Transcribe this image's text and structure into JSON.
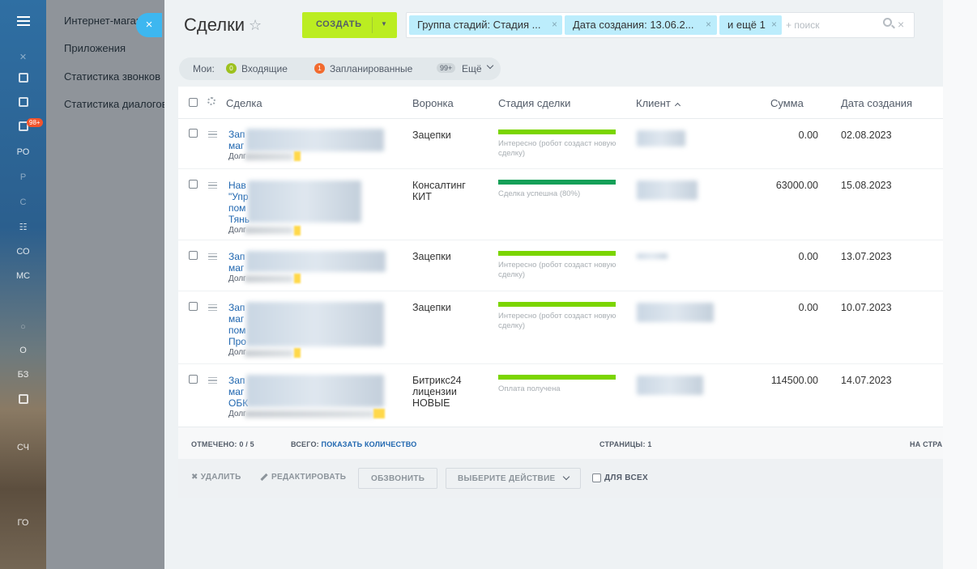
{
  "rail": {
    "items": [
      {
        "label": "",
        "top": 0
      },
      {
        "label": "РО"
      },
      {
        "label": "Р"
      },
      {
        "label": "С"
      },
      {
        "label": "СО"
      },
      {
        "label": "МС"
      },
      {
        "label": "О"
      },
      {
        "label": "БЗ"
      },
      {
        "label": "СЧ"
      },
      {
        "label": "ГО"
      }
    ],
    "badge": "98+"
  },
  "submenu": {
    "items": [
      "Интернет-магазин",
      "Приложения",
      "Статистика звонков",
      "Статистика диалогов"
    ],
    "close_icon": "×"
  },
  "header": {
    "title": "Сделки",
    "star_icon": "☆",
    "create_label": "СОЗДАТЬ",
    "create_arrow": "▼"
  },
  "filter": {
    "chips": [
      "Группа стадий: Стадия ...",
      "Дата создания: 13.06.2...",
      "и ещё 1"
    ],
    "chip_close": "×",
    "search_placeholder": "+ поиск",
    "clear_icon": "×"
  },
  "counters": {
    "label": "Мои:",
    "incoming": "Входящие",
    "incoming_badge": "0",
    "planned": "Запланированные",
    "planned_badge": "1",
    "more_badge": "99+",
    "more": "Ещё"
  },
  "grid": {
    "columns": [
      "Сделка",
      "Воронка",
      "Стадия сделки",
      "Клиент",
      "Сумма",
      "Дата создания"
    ],
    "rows": [
      {
        "deal_lines": [
          "Зап",
          "маг"
        ],
        "resp": "Долг",
        "funnel": [
          "Зацепки"
        ],
        "stage": "Интересно (робот создаст новую сделку)",
        "stage_type": "interest",
        "amount": "0.00",
        "date": "02.08.2023"
      },
      {
        "deal_lines": [
          "Нав",
          "\"Упр",
          "пом",
          "Тянь"
        ],
        "resp": "Долг",
        "funnel": [
          "Консалтинг",
          "КИТ"
        ],
        "stage": "Сделка успешна (80%)",
        "stage_type": "success",
        "amount": "63000.00",
        "date": "15.08.2023"
      },
      {
        "deal_lines": [
          "Зап",
          "маг"
        ],
        "resp": "Долг",
        "funnel": [
          "Зацепки"
        ],
        "stage": "Интересно (робот создаст новую сделку)",
        "stage_type": "interest",
        "amount": "0.00",
        "date": "13.07.2023"
      },
      {
        "deal_lines": [
          "Зап",
          "маг",
          "пом",
          "Про"
        ],
        "resp": "Долг",
        "funnel": [
          "Зацепки"
        ],
        "stage": "Интересно (робот создаст новую сделку)",
        "stage_type": "interest",
        "amount": "0.00",
        "date": "10.07.2023"
      },
      {
        "deal_lines": [
          "Зап",
          "маг",
          "ОБК"
        ],
        "resp": "Долг",
        "funnel": [
          "Битрикс24",
          "лицензии",
          "НОВЫЕ"
        ],
        "stage": "Оплата получена",
        "stage_type": "interest",
        "amount": "114500.00",
        "date": "14.07.2023"
      }
    ]
  },
  "footer": {
    "checked": "ОТМЕЧЕНО: 0 / 5",
    "total_label": "ВСЕГО:",
    "total_link": "ПОКАЗАТЬ КОЛИЧЕСТВО",
    "pages": "СТРАНИЦЫ: 1",
    "per_page": "НА СТРА"
  },
  "actions": {
    "delete": "УДАЛИТЬ",
    "delete_icon": "✖",
    "edit": "РЕДАКТИРОВАТЬ",
    "call": "ОБЗВОНИТЬ",
    "select_action": "ВЫБЕРИТЕ ДЕЙСТВИЕ",
    "for_all": "ДЛЯ ВСЕХ"
  },
  "colors": {
    "create_button": "#bbed21",
    "chip": "#bcedfc",
    "stage_interest": "#7bd500",
    "stage_success": "#15a058",
    "close_button": "#3db7f0",
    "link": "#2067b0"
  }
}
